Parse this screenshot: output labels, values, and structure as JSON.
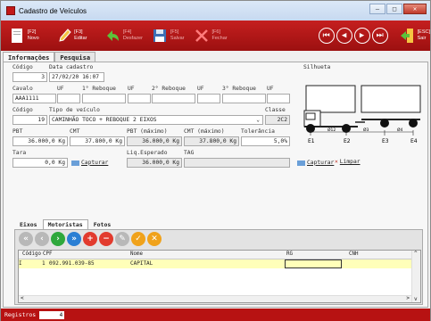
{
  "window": {
    "title": "Cadastro de Veículos"
  },
  "toolbar": {
    "novo": "[F2] Novo",
    "editar": "[F3] Editar",
    "desfazer_key": "[F4]",
    "desfazer": "Desfazer",
    "salvar_key": "[F5]",
    "salvar": "Salvar",
    "fechar_key": "[F6]",
    "fechar": "Fechar",
    "sair_key": "[ESC]",
    "sair": "Sair"
  },
  "tabs": [
    "Informações",
    "Pesquisa"
  ],
  "labels": {
    "codigo": "Código",
    "data_cadastro": "Data cadastro",
    "silhueta": "Silhueta",
    "cavalo": "Cavalo",
    "uf": "UF",
    "reboque1": "1° Reboque",
    "reboque2": "2° Reboque",
    "reboque3": "3° Reboque",
    "tipo_veiculo": "Tipo de veículo",
    "classe": "Classe",
    "pbt": "PBT",
    "cmt": "CMT",
    "pbt_max": "PBT (máximo)",
    "cmt_max": "CMT (máximo)",
    "tolerancia": "Tolerância",
    "tara": "Tara",
    "liq_esperado": "Liq.Esperado",
    "tag": "TAG",
    "capturar": "Capturar",
    "limpar": "Limpar"
  },
  "form": {
    "codigo": "3",
    "data_cadastro": "27/02/20 16:07",
    "cavalo": "AAA1111",
    "tipo_codigo": "19",
    "tipo_nome": "CAMINHÃO TOCO + REBOQUE 2 EIXOS",
    "classe": "2C2",
    "pbt": "36.000,0 Kg",
    "cmt": "37.800,0 Kg",
    "pbt_max": "36.000,0 Kg",
    "cmt_max": "37.800,0 Kg",
    "tolerancia": "5,0%",
    "tara": "0,0 Kg",
    "liq_esperado": "36.000,0 Kg"
  },
  "silhueta": {
    "dims": [
      "Ø12",
      "Ø3",
      "Ø4"
    ],
    "axles": [
      "E1",
      "E2",
      "E3",
      "E4"
    ]
  },
  "subtabs": [
    "Eixos",
    "Motoristas",
    "Fotos"
  ],
  "grid": {
    "headers": [
      "Código",
      "CPF",
      "Nome",
      "RG",
      "CNH"
    ],
    "rows": [
      {
        "codigo": "1",
        "cpf": "092.991.039-85",
        "nome": "CAPITAL",
        "rg": "",
        "cnh": ""
      }
    ]
  },
  "status": {
    "registros_label": "Registros",
    "registros_count": "4"
  }
}
